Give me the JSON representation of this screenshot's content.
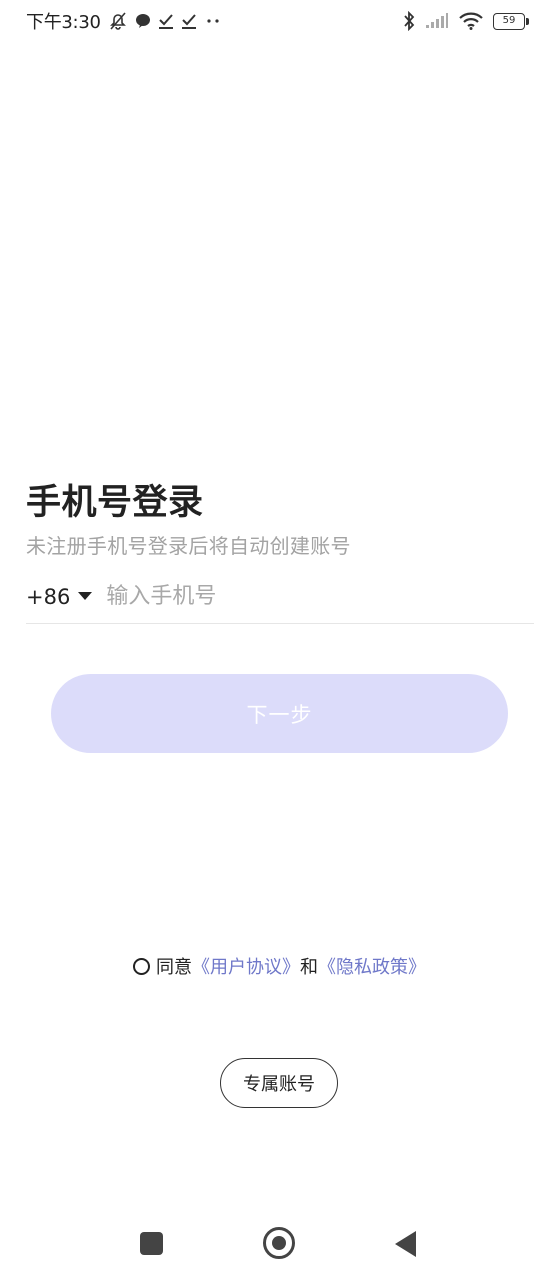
{
  "status_bar": {
    "time": "下午3:30",
    "battery": "59",
    "icons": [
      "mute-icon",
      "chat-icon",
      "checkmark-icon",
      "checkmark-icon",
      "more-dots-icon",
      "bluetooth-icon",
      "signal-icon",
      "wifi-icon",
      "battery-icon"
    ]
  },
  "login": {
    "title": "手机号登录",
    "subtitle": "未注册手机号登录后将自动创建账号",
    "country_code": "+86",
    "phone_placeholder": "输入手机号",
    "phone_value": "",
    "next_label": "下一步"
  },
  "agreement": {
    "prefix": "同意",
    "user_agreement": "《用户协议》",
    "and": "和",
    "privacy_policy": "《隐私政策》"
  },
  "exclusive_account": {
    "label": "专属账号"
  },
  "colors": {
    "accent_link": "#6f78c9",
    "button_disabled": "#dcdcfa",
    "text_primary": "#222222",
    "text_secondary": "#a3a3a3"
  },
  "nav_bar": {
    "buttons": [
      "recent-apps-icon",
      "home-icon",
      "back-icon"
    ]
  }
}
